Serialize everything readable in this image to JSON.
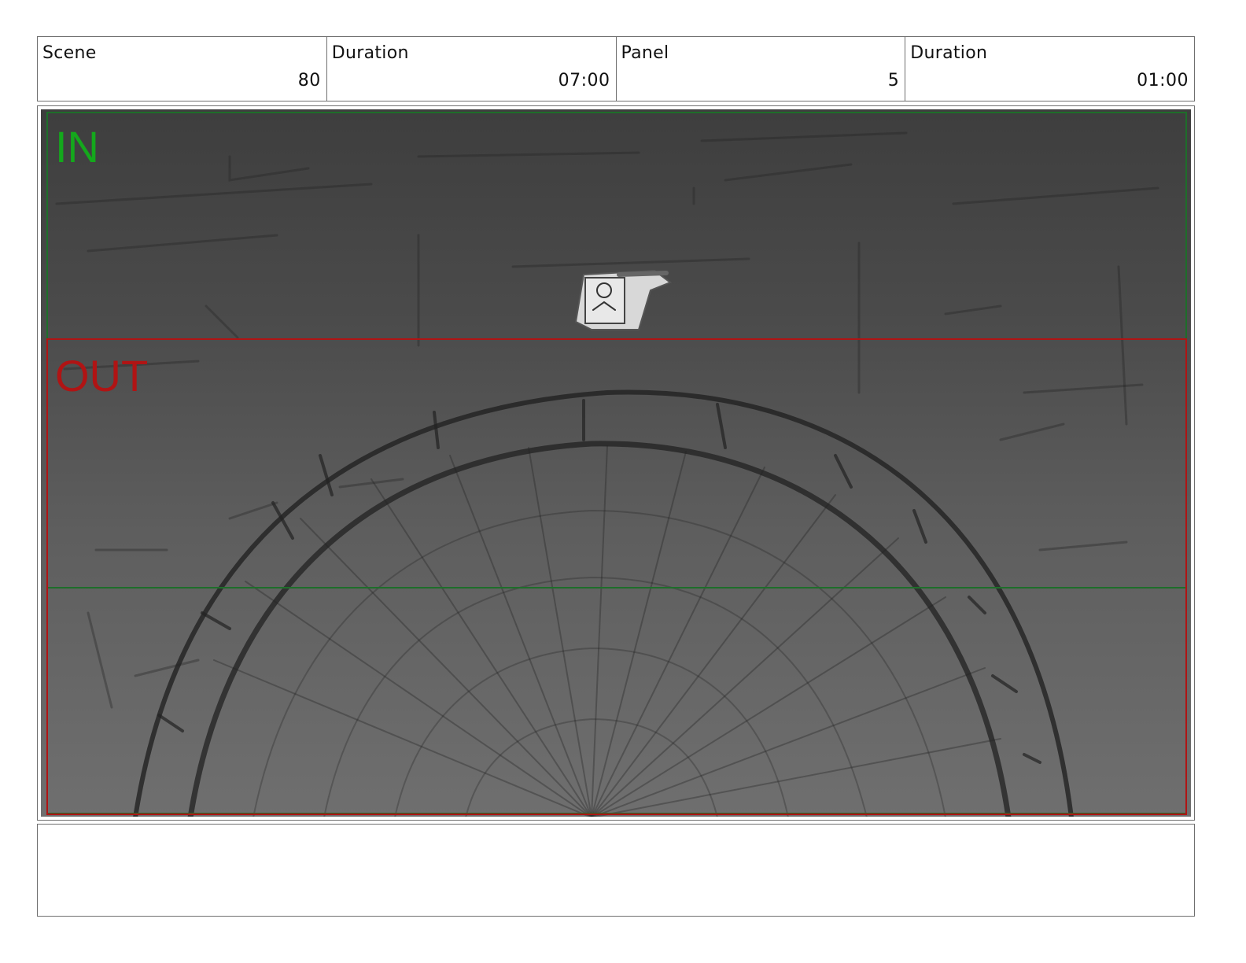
{
  "header": {
    "scene_label": "Scene",
    "scene_value": "80",
    "scene_duration_label": "Duration",
    "scene_duration_value": "07:00",
    "panel_label": "Panel",
    "panel_value": "5",
    "panel_duration_label": "Duration",
    "panel_duration_value": "01:00"
  },
  "panel": {
    "in_label": "IN",
    "out_label": "OUT",
    "colors": {
      "in_frame": "#1e6e2a",
      "in_text": "#14a81c",
      "out_frame": "#b01414",
      "out_text": "#b01414",
      "sketch": "#2a2a2a"
    }
  },
  "notes": {
    "text": ""
  }
}
